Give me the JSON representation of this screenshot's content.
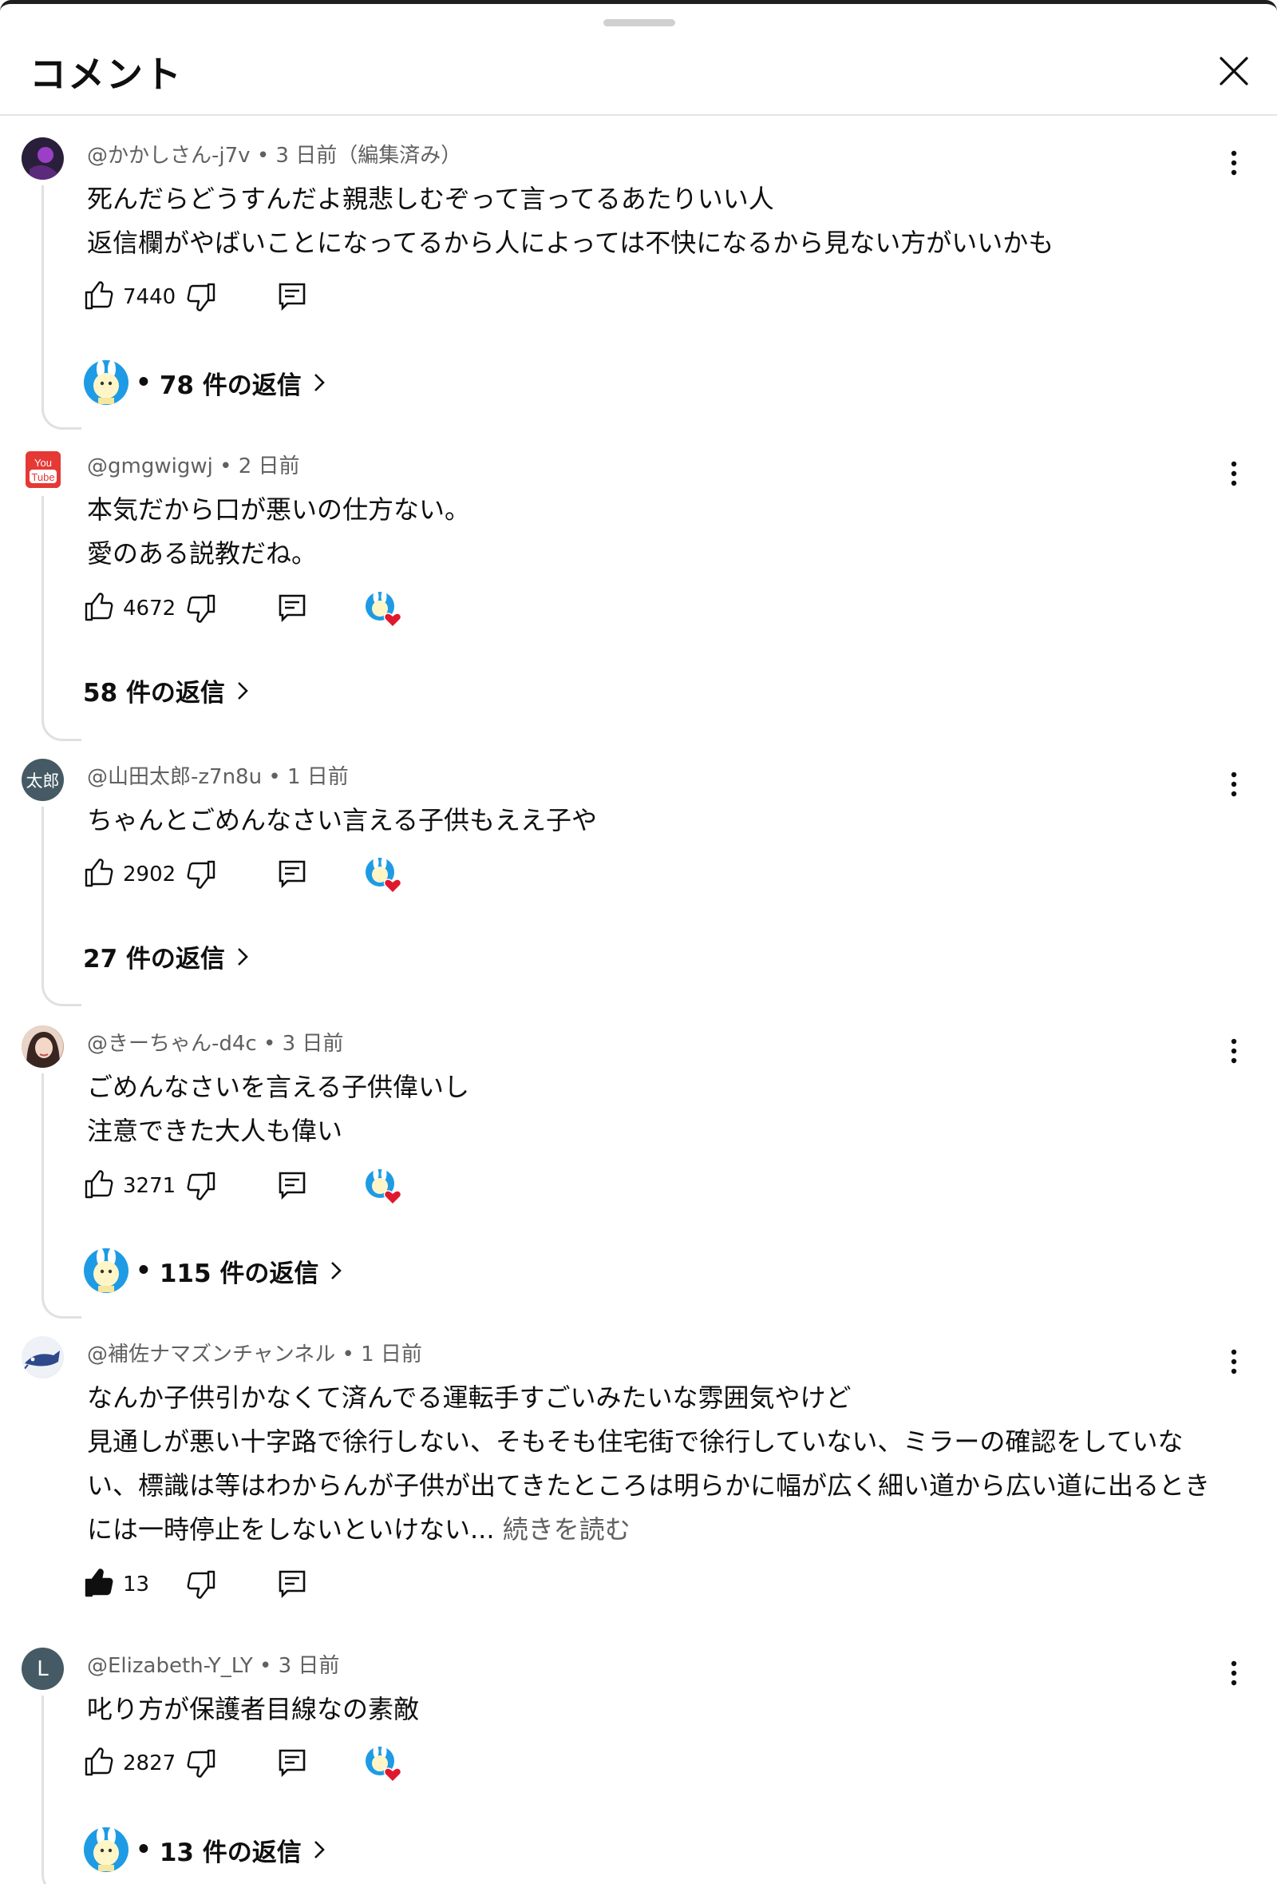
{
  "header": {
    "title": "コメント"
  },
  "comments": [
    {
      "author": "@かかしさん-j7v",
      "time": "3 日前（編集済み）",
      "lines": [
        "死んだらどうすんだよ親悲しむぞって言ってるあたりいい人",
        "返信欄がやばいことになってるから人によっては不快になるから見ない方がいいかも"
      ],
      "likes": "7440",
      "replies": "78 件の返信",
      "avatar_color": "#3a2a4a"
    },
    {
      "author": "@gmgwigwj",
      "time": "2 日前",
      "lines": [
        "本気だから口が悪いの仕方ない。",
        "愛のある説教だね。"
      ],
      "likes": "4672",
      "replies": "58 件の返信",
      "avatar_color": "#e53935",
      "avatar_text": "You Tube"
    },
    {
      "author": "@山田太郎-z7n8u",
      "time": "1 日前",
      "lines": [
        "ちゃんとごめんなさい言える子供もええ子や"
      ],
      "likes": "2902",
      "replies": "27 件の返信",
      "avatar_color": "#455a64",
      "avatar_text": "太郎"
    },
    {
      "author": "@きーちゃん-d4c",
      "time": "3 日前",
      "lines": [
        "ごめんなさいを言える子供偉いし",
        "注意できた大人も偉い"
      ],
      "likes": "3271",
      "replies": "115 件の返信",
      "avatar_color": "#c9a58e"
    },
    {
      "author": "@補佐ナマズンチャンネル",
      "time": "1 日前",
      "lines": [
        "なんか子供引かなくて済んでる運転手すごいみたいな雰囲気やけど",
        "見通しが悪い十字路で徐行しない、そもそも住宅街で徐行していない、ミラーの確認をしていな",
        "い、標識は等はわからんが子供が出てきたところは明らかに幅が広く細い道から広い道に出るとき",
        "には一時停止をしないといけない..."
      ],
      "read_more": "続きを読む",
      "likes": "13",
      "avatar_color": "#e8eef5"
    },
    {
      "author": "@Elizabeth-Y_LY",
      "time": "3 日前",
      "lines": [
        "叱り方が保護者目線なの素敵"
      ],
      "likes": "2827",
      "replies": "13 件の返信",
      "avatar_color": "#455a64",
      "avatar_text": "L"
    }
  ],
  "separator": "•"
}
